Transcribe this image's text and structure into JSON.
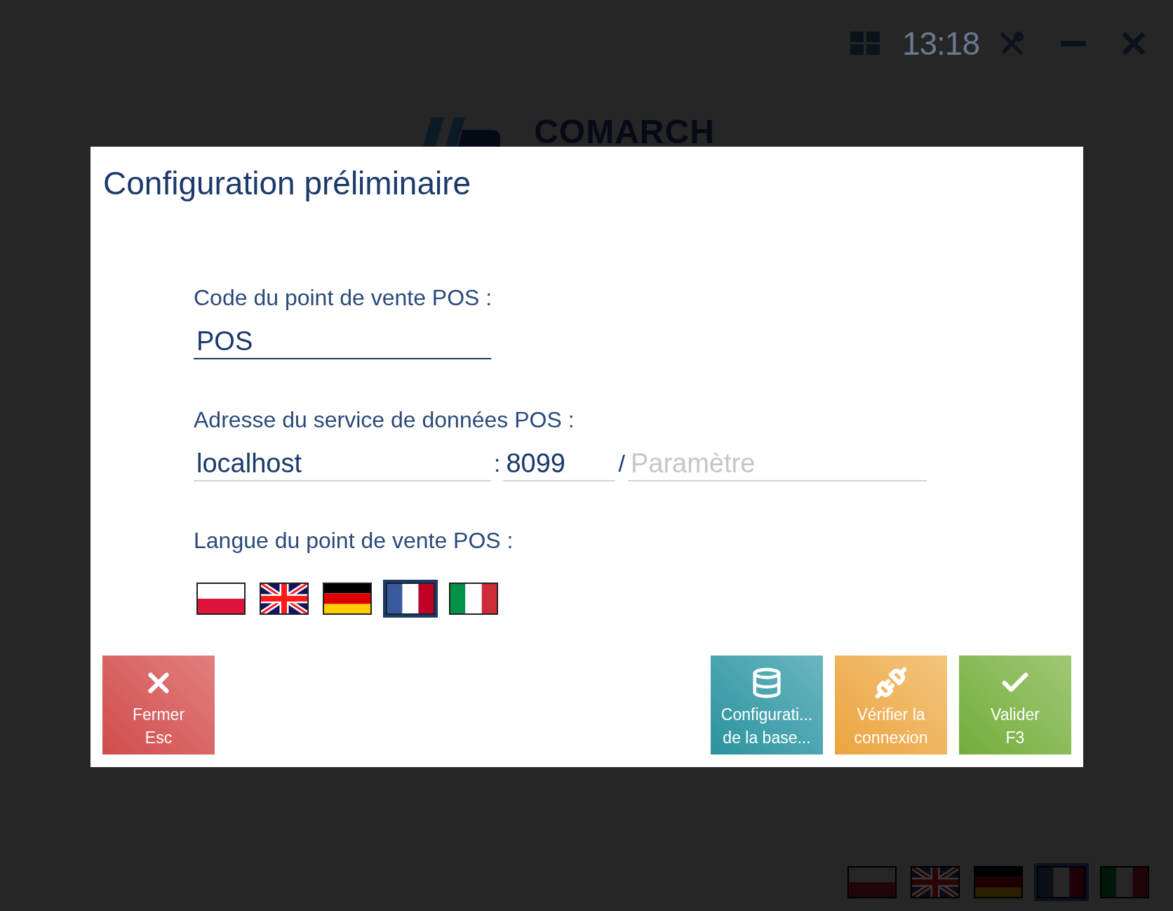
{
  "top_bar": {
    "time": "13:18"
  },
  "logo": {
    "text": "COMARCH"
  },
  "dialog": {
    "title": "Configuration préliminaire",
    "pos_code": {
      "label": "Code du point de vente POS :",
      "value": "POS"
    },
    "service_address": {
      "label": "Adresse du service de données POS :",
      "host": "localhost",
      "port_separator": ":",
      "port": "8099",
      "path_separator": "/",
      "path_placeholder": "Paramètre"
    },
    "language": {
      "label": "Langue du point de vente POS :",
      "flags": [
        {
          "kind": "pl",
          "selected": false
        },
        {
          "kind": "gb",
          "selected": false
        },
        {
          "kind": "de",
          "selected": false
        },
        {
          "kind": "fr",
          "selected": true
        },
        {
          "kind": "it",
          "selected": false
        }
      ]
    },
    "buttons": [
      {
        "kind": "close",
        "label": "Fermer\nEsc"
      },
      {
        "kind": "database",
        "label": "Configurati...\nde la base..."
      },
      {
        "kind": "connection",
        "label": "Vérifier la\nconnexion"
      },
      {
        "kind": "confirm",
        "label": "Valider\nF3"
      }
    ]
  },
  "background_flags": [
    {
      "kind": "pl",
      "selected": false
    },
    {
      "kind": "gb",
      "selected": false
    },
    {
      "kind": "de",
      "selected": false
    },
    {
      "kind": "fr",
      "selected": true
    },
    {
      "kind": "it",
      "selected": false
    }
  ]
}
